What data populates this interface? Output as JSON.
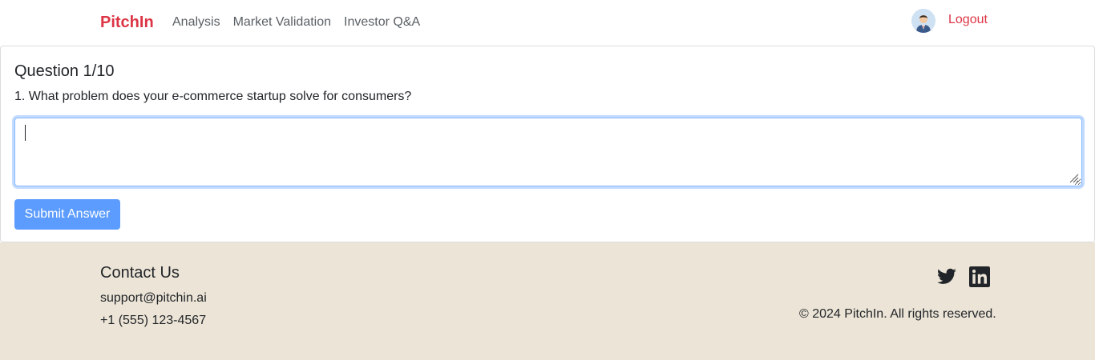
{
  "navbar": {
    "brand": "PitchIn",
    "links": [
      {
        "label": "Analysis"
      },
      {
        "label": "Market Validation"
      },
      {
        "label": "Investor Q&A"
      }
    ],
    "avatar_icon": "user-avatar-icon",
    "logout_label": "Logout",
    "brand_color": "#dc3545"
  },
  "question": {
    "counter": "Question 1/10",
    "text": "1. What problem does your e-commerce startup solve for consumers?",
    "answer_value": "",
    "submit_label": "Submit Answer",
    "submit_color": "#5c9cff"
  },
  "footer": {
    "contact_title": "Contact Us",
    "email": "support@pitchin.ai",
    "phone": "+1 (555) 123-4567",
    "social": [
      {
        "icon": "twitter-icon"
      },
      {
        "icon": "linkedin-icon"
      }
    ],
    "copyright": "© 2024 PitchIn. All rights reserved.",
    "background": "#ece4d6"
  }
}
